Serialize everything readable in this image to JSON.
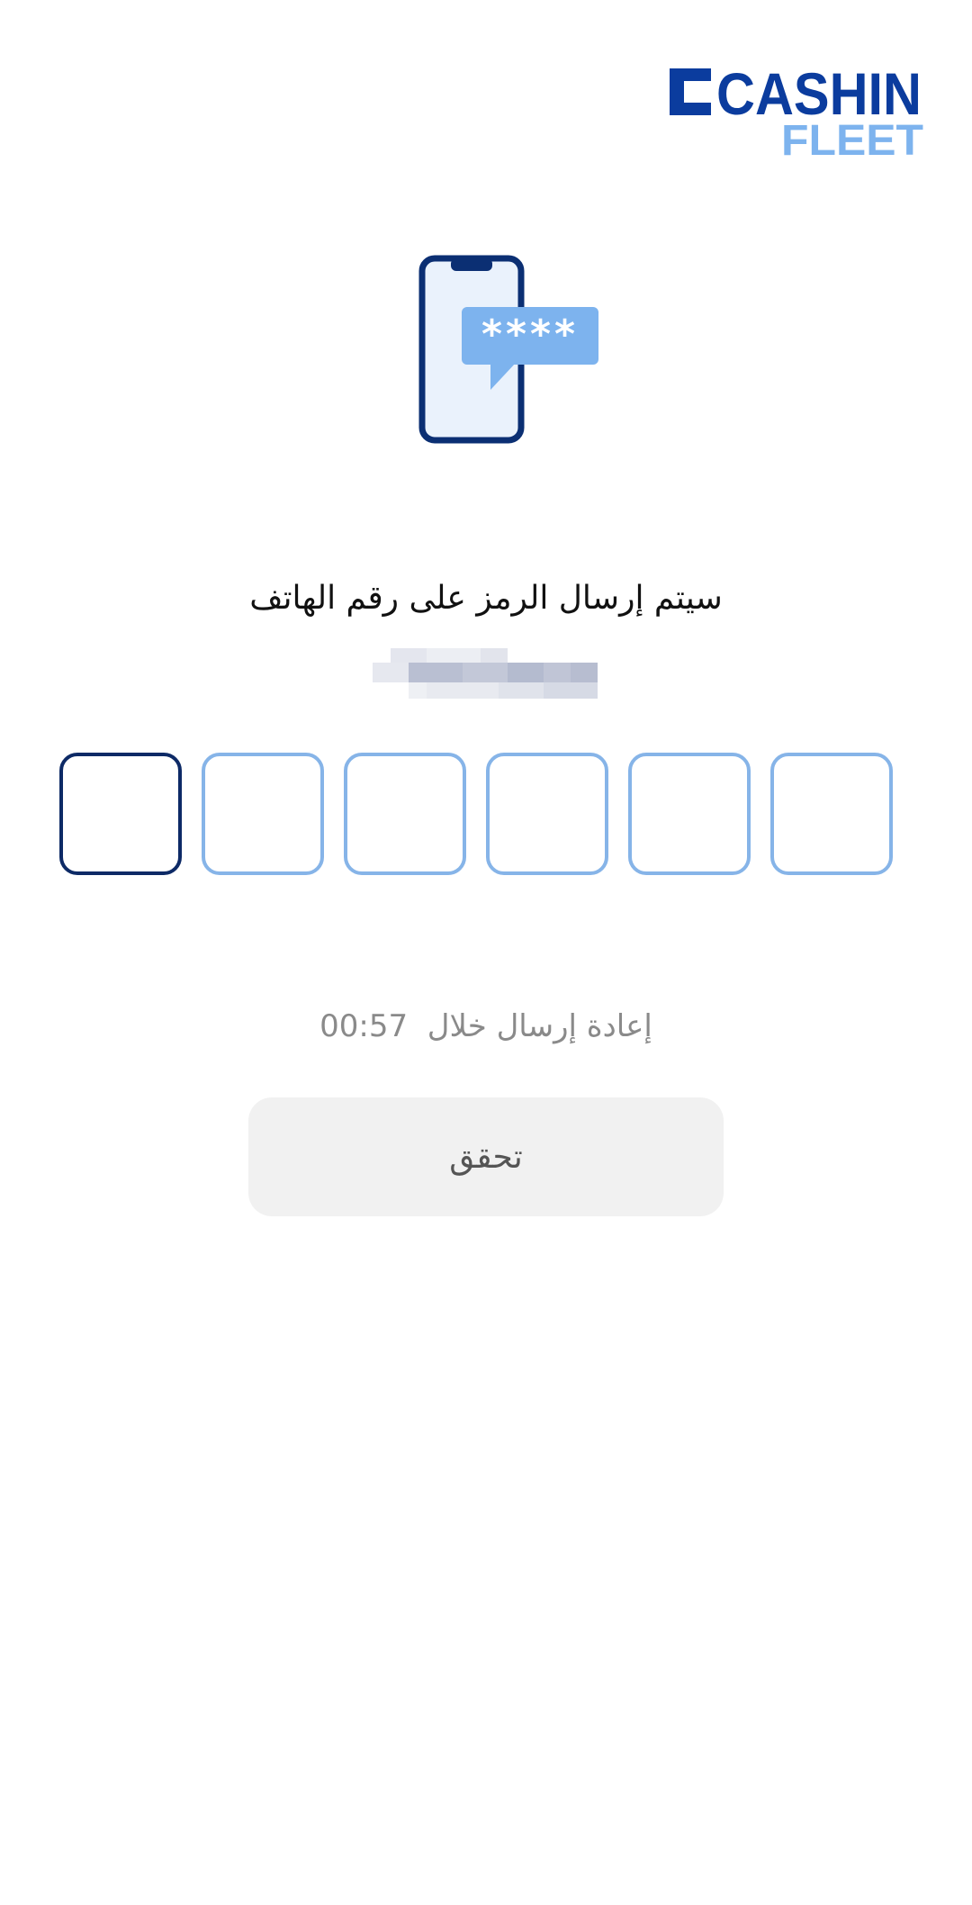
{
  "logo": {
    "line1": "CASHIN",
    "line2": "FLEET",
    "colors": {
      "primary": "#0b3c9e",
      "secondary": "#7db3ee"
    }
  },
  "illustration": {
    "icon": "phone-sms-code-icon",
    "code_mask": "****"
  },
  "instruction": "سيتم إرسال الرمز على رقم الهاتف",
  "phone_number": {
    "state": "blurred"
  },
  "otp": {
    "digits": [
      "",
      "",
      "",
      "",
      "",
      ""
    ],
    "active_index": 0,
    "colors": {
      "active": "#0d2a66",
      "inactive": "#86b4e8"
    }
  },
  "resend": {
    "label": "إعادة إرسال خلال",
    "timer": "00:57"
  },
  "verify_button": {
    "label": "تحقق"
  }
}
